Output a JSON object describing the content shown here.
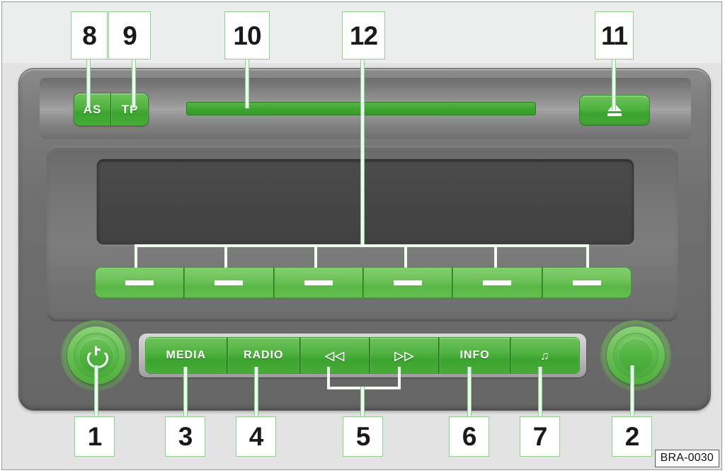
{
  "figure": {
    "image_code": "BRA-0030",
    "description": "Car radio front panel control diagram with numbered callouts"
  },
  "colors": {
    "accent_green": "#4fb23f",
    "light_green": "#6cc157",
    "callout_border": "#8fd18a",
    "body_gray": "#6f6f6f",
    "display_dark": "#464646",
    "background": "#e3e3e3"
  },
  "controls": {
    "as_button": {
      "label": "AS",
      "callout": "8"
    },
    "tp_button": {
      "label": "TP",
      "callout": "9"
    },
    "cd_slot": {
      "label": "",
      "callout": "10"
    },
    "eject_button": {
      "label": "",
      "icon": "eject-icon",
      "callout": "11"
    },
    "preset_buttons": {
      "callout": "12",
      "count": 6,
      "label": ""
    },
    "power_knob": {
      "label": "",
      "icon": "power-icon",
      "callout": "1"
    },
    "volume_knob": {
      "label": "",
      "icon": "rotary-knob-icon",
      "callout": "2"
    },
    "media_button": {
      "label": "MEDIA",
      "callout": "3"
    },
    "radio_button": {
      "label": "RADIO",
      "callout": "4"
    },
    "rewind_button": {
      "label": "◁◁",
      "icon": "rewind-icon",
      "callout": "5"
    },
    "forward_button": {
      "label": "▷▷",
      "icon": "fast-forward-icon",
      "callout": "5"
    },
    "info_button": {
      "label": "INFO",
      "callout": "6"
    },
    "sound_button": {
      "label": "♫",
      "icon": "music-note-icon",
      "callout": "7"
    }
  },
  "callouts": [
    {
      "id": "c8",
      "number": "8"
    },
    {
      "id": "c9",
      "number": "9"
    },
    {
      "id": "c10",
      "number": "10"
    },
    {
      "id": "c12",
      "number": "12"
    },
    {
      "id": "c11",
      "number": "11"
    },
    {
      "id": "c1",
      "number": "1"
    },
    {
      "id": "c3",
      "number": "3"
    },
    {
      "id": "c4",
      "number": "4"
    },
    {
      "id": "c5",
      "number": "5"
    },
    {
      "id": "c6",
      "number": "6"
    },
    {
      "id": "c7",
      "number": "7"
    },
    {
      "id": "c2",
      "number": "2"
    }
  ]
}
